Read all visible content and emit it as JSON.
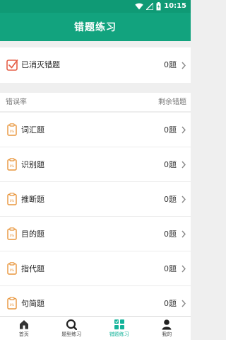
{
  "status_bar": {
    "time": "10:15"
  },
  "header": {
    "title": "错题练习"
  },
  "resolved": {
    "label": "已消灭错题",
    "count": "0题"
  },
  "list_header": {
    "left": "错误率",
    "right": "剩余错题"
  },
  "categories": [
    {
      "label": "词汇题",
      "count": "0题"
    },
    {
      "label": "识别题",
      "count": "0题"
    },
    {
      "label": "推断题",
      "count": "0题"
    },
    {
      "label": "目的题",
      "count": "0题"
    },
    {
      "label": "指代题",
      "count": "0题"
    },
    {
      "label": "句简题",
      "count": "0题"
    }
  ],
  "tabbar": {
    "items": [
      {
        "label": "首页",
        "icon": "home-icon"
      },
      {
        "label": "题型练习",
        "icon": "search-icon"
      },
      {
        "label": "错题练习",
        "icon": "grid-icon",
        "active": true
      },
      {
        "label": "我的",
        "icon": "person-icon"
      }
    ]
  },
  "colors": {
    "header": "#12a37e",
    "accent": "#14b39a",
    "icon_orange": "#e8953b",
    "resolved_red": "#e5614a"
  }
}
